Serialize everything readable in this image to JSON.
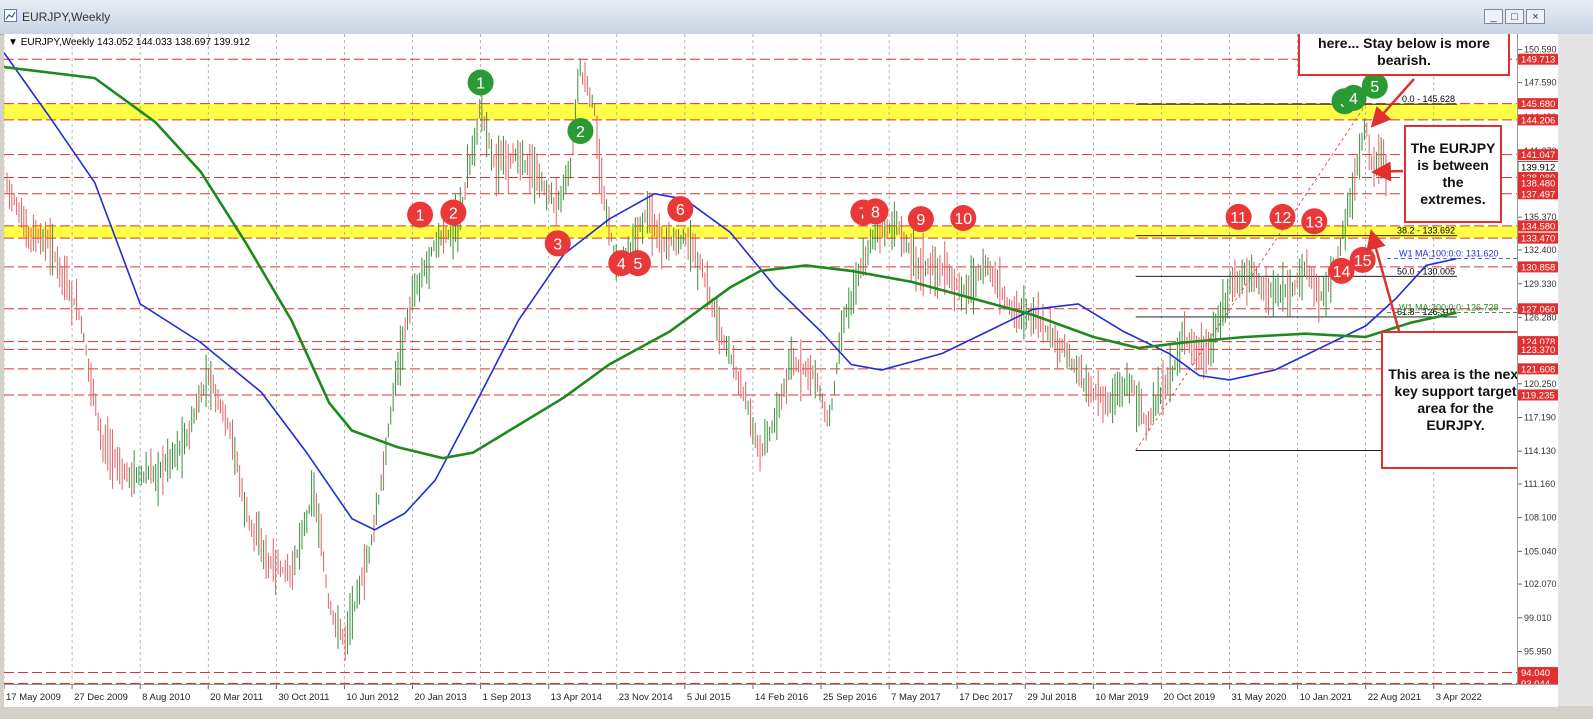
{
  "window": {
    "title": "EURJPY,Weekly",
    "icon": "chart-window-icon",
    "buttons": [
      "_",
      "□",
      "×"
    ]
  },
  "symbol_line": "EURJPY,Weekly  143.052 144.033 138.697 139.912",
  "callouts": {
    "top": "Resistance stalled the rally here... Stay below is more bearish.",
    "middle": "The EURJPY is between the extremes.",
    "bottom": "This area is the next key support target area for the EURJPY."
  },
  "colors": {
    "bull_bar": "#3a8f3a",
    "bear_bar": "#e06060",
    "ma100": "#1f2fcf",
    "ma200": "#1e8a1e",
    "zone": "#ffff33",
    "resistance": "#e03030",
    "fib": "#000000"
  },
  "chart_data": {
    "type": "candlestick",
    "title": "EURJPY,Weekly",
    "timeframe": "Weekly",
    "ohlc_last": {
      "open": 143.052,
      "high": 144.033,
      "low": 138.697,
      "close": 139.912
    },
    "ylim": [
      93.0,
      152.0
    ],
    "xlabel": "",
    "ylabel": "",
    "x_ticks": [
      "17 May 2009",
      "27 Dec 2009",
      "8 Aug 2010",
      "20 Mar 2011",
      "30 Oct 2011",
      "10 Jun 2012",
      "20 Jan 2013",
      "1 Sep 2013",
      "13 Apr 2014",
      "23 Nov 2014",
      "5 Jul 2015",
      "14 Feb 2016",
      "25 Sep 2016",
      "7 May 2017",
      "17 Dec 2017",
      "29 Jul 2018",
      "10 Mar 2019",
      "20 Oct 2019",
      "31 May 2020",
      "10 Jan 2021",
      "22 Aug 2021",
      "3 Apr 2022"
    ],
    "x_tick_frac": [
      0.0,
      0.045,
      0.09,
      0.135,
      0.18,
      0.225,
      0.27,
      0.315,
      0.36,
      0.405,
      0.45,
      0.495,
      0.54,
      0.585,
      0.63,
      0.675,
      0.72,
      0.765,
      0.81,
      0.855,
      0.9,
      0.945
    ],
    "y_tick_labels": [
      "150.590",
      "147.590",
      "144.480",
      "141.370",
      "138.470",
      "135.370",
      "132.400",
      "129.330",
      "126.280",
      "123.310",
      "120.250",
      "117.190",
      "114.130",
      "111.160",
      "108.100",
      "105.040",
      "102.070",
      "99.010",
      "95.950",
      "92.980"
    ],
    "y_ticks": [
      150.59,
      147.59,
      144.48,
      141.37,
      138.47,
      135.37,
      132.4,
      129.33,
      126.28,
      123.31,
      120.25,
      117.19,
      114.13,
      111.16,
      108.1,
      105.04,
      102.07,
      99.01,
      95.95,
      92.98
    ],
    "price_boxes": [
      {
        "label": "149.713",
        "value": 149.713
      },
      {
        "label": "145.680",
        "value": 145.68
      },
      {
        "label": "144.206",
        "value": 144.206
      },
      {
        "label": "141.047",
        "value": 141.047
      },
      {
        "label": "139.912",
        "value": 139.912,
        "kind": "current"
      },
      {
        "label": "138.980",
        "value": 138.98
      },
      {
        "label": "138.480",
        "value": 138.48
      },
      {
        "label": "137.497",
        "value": 137.497
      },
      {
        "label": "134.580",
        "value": 134.58
      },
      {
        "label": "133.470",
        "value": 133.47
      },
      {
        "label": "130.858",
        "value": 130.858
      },
      {
        "label": "127.060",
        "value": 127.06
      },
      {
        "label": "124.078",
        "value": 124.078
      },
      {
        "label": "123.370",
        "value": 123.37
      },
      {
        "label": "121.608",
        "value": 121.608
      },
      {
        "label": "119.235",
        "value": 119.235
      },
      {
        "label": "94.040",
        "value": 94.04
      },
      {
        "label": "93.044",
        "value": 93.044
      }
    ],
    "resistance_lines": [
      149.713,
      145.68,
      144.206,
      141.047,
      138.98,
      137.497,
      134.58,
      133.47,
      130.858,
      127.06,
      124.078,
      123.37,
      121.608,
      119.235,
      94.04,
      93.044
    ],
    "zones": [
      {
        "from": 144.206,
        "to": 145.68
      },
      {
        "from": 133.47,
        "to": 134.58
      }
    ],
    "fib_levels": [
      {
        "label": "0.0 - 145.628",
        "value": 145.628
      },
      {
        "label": "38.2 - 133.692",
        "value": 133.692
      },
      {
        "label": "50.0 - 130.005",
        "value": 130.005
      },
      {
        "label": "61.8 - 126.319",
        "value": 126.319
      }
    ],
    "fib_anchor_low": 114.2,
    "ma_labels": [
      {
        "label": "W1 MA:100:0:0: 131.620",
        "value": 131.62
      },
      {
        "label": "W1 MA:200:0:0: 126.728",
        "value": 126.728
      }
    ],
    "ma100": [
      [
        0.0,
        150.3
      ],
      [
        0.03,
        144.5
      ],
      [
        0.06,
        138.5
      ],
      [
        0.09,
        127.5
      ],
      [
        0.13,
        124.0
      ],
      [
        0.17,
        119.5
      ],
      [
        0.2,
        114.0
      ],
      [
        0.23,
        108.0
      ],
      [
        0.245,
        107.0
      ],
      [
        0.265,
        108.5
      ],
      [
        0.285,
        111.5
      ],
      [
        0.31,
        118.0
      ],
      [
        0.34,
        126.0
      ],
      [
        0.37,
        132.0
      ],
      [
        0.4,
        135.2
      ],
      [
        0.43,
        137.5
      ],
      [
        0.45,
        137.0
      ],
      [
        0.48,
        134.0
      ],
      [
        0.51,
        129.0
      ],
      [
        0.54,
        125.0
      ],
      [
        0.56,
        122.0
      ],
      [
        0.58,
        121.5
      ],
      [
        0.62,
        123.0
      ],
      [
        0.65,
        125.0
      ],
      [
        0.68,
        127.0
      ],
      [
        0.71,
        127.5
      ],
      [
        0.74,
        125.0
      ],
      [
        0.77,
        123.0
      ],
      [
        0.79,
        121.0
      ],
      [
        0.81,
        120.6
      ],
      [
        0.84,
        121.5
      ],
      [
        0.87,
        123.5
      ],
      [
        0.9,
        125.5
      ],
      [
        0.92,
        128.0
      ],
      [
        0.94,
        131.0
      ],
      [
        0.96,
        131.6
      ]
    ],
    "ma200": [
      [
        0.0,
        149.0
      ],
      [
        0.06,
        148.0
      ],
      [
        0.1,
        144.0
      ],
      [
        0.13,
        139.5
      ],
      [
        0.16,
        133.0
      ],
      [
        0.19,
        126.0
      ],
      [
        0.215,
        118.5
      ],
      [
        0.23,
        116.0
      ],
      [
        0.26,
        114.5
      ],
      [
        0.29,
        113.5
      ],
      [
        0.31,
        114.0
      ],
      [
        0.34,
        116.5
      ],
      [
        0.37,
        119.0
      ],
      [
        0.4,
        122.0
      ],
      [
        0.44,
        125.0
      ],
      [
        0.48,
        129.0
      ],
      [
        0.5,
        130.5
      ],
      [
        0.53,
        131.0
      ],
      [
        0.56,
        130.5
      ],
      [
        0.6,
        129.5
      ],
      [
        0.64,
        128.0
      ],
      [
        0.68,
        126.5
      ],
      [
        0.72,
        124.5
      ],
      [
        0.75,
        123.5
      ],
      [
        0.78,
        124.0
      ],
      [
        0.82,
        124.5
      ],
      [
        0.86,
        124.8
      ],
      [
        0.9,
        124.5
      ],
      [
        0.93,
        125.8
      ],
      [
        0.96,
        126.7
      ]
    ],
    "price_path": [
      [
        0.0,
        139.3
      ],
      [
        0.015,
        134.0
      ],
      [
        0.03,
        133.0
      ],
      [
        0.05,
        126.5
      ],
      [
        0.065,
        115.0
      ],
      [
        0.08,
        112.0
      ],
      [
        0.1,
        112.0
      ],
      [
        0.12,
        115.0
      ],
      [
        0.135,
        121.0
      ],
      [
        0.15,
        116.0
      ],
      [
        0.16,
        108.5
      ],
      [
        0.175,
        104.0
      ],
      [
        0.19,
        103.0
      ],
      [
        0.205,
        110.5
      ],
      [
        0.215,
        100.0
      ],
      [
        0.225,
        97.0
      ],
      [
        0.24,
        104.0
      ],
      [
        0.25,
        111.5
      ],
      [
        0.26,
        122.0
      ],
      [
        0.27,
        128.0
      ],
      [
        0.285,
        133.0
      ],
      [
        0.3,
        134.5
      ],
      [
        0.31,
        141.5
      ],
      [
        0.315,
        145.5
      ],
      [
        0.325,
        140.0
      ],
      [
        0.34,
        141.0
      ],
      [
        0.355,
        138.5
      ],
      [
        0.365,
        136.5
      ],
      [
        0.375,
        140.0
      ],
      [
        0.38,
        149.0
      ],
      [
        0.39,
        145.5
      ],
      [
        0.395,
        138.0
      ],
      [
        0.405,
        131.0
      ],
      [
        0.415,
        132.5
      ],
      [
        0.425,
        136.0
      ],
      [
        0.435,
        133.0
      ],
      [
        0.45,
        133.5
      ],
      [
        0.46,
        131.0
      ],
      [
        0.475,
        124.5
      ],
      [
        0.49,
        119.0
      ],
      [
        0.5,
        114.0
      ],
      [
        0.51,
        117.0
      ],
      [
        0.52,
        122.0
      ],
      [
        0.535,
        121.5
      ],
      [
        0.545,
        116.5
      ],
      [
        0.555,
        126.0
      ],
      [
        0.565,
        130.0
      ],
      [
        0.575,
        134.0
      ],
      [
        0.59,
        134.5
      ],
      [
        0.605,
        131.0
      ],
      [
        0.62,
        130.5
      ],
      [
        0.635,
        128.5
      ],
      [
        0.65,
        131.0
      ],
      [
        0.665,
        127.0
      ],
      [
        0.68,
        126.5
      ],
      [
        0.7,
        123.5
      ],
      [
        0.715,
        120.0
      ],
      [
        0.73,
        118.5
      ],
      [
        0.745,
        120.5
      ],
      [
        0.755,
        116.5
      ],
      [
        0.77,
        120.5
      ],
      [
        0.78,
        124.5
      ],
      [
        0.795,
        122.5
      ],
      [
        0.81,
        129.0
      ],
      [
        0.825,
        130.5
      ],
      [
        0.835,
        128.5
      ],
      [
        0.85,
        128.5
      ],
      [
        0.86,
        131.0
      ],
      [
        0.87,
        128.0
      ],
      [
        0.88,
        131.0
      ],
      [
        0.89,
        137.0
      ],
      [
        0.9,
        144.0
      ],
      [
        0.905,
        139.5
      ],
      [
        0.91,
        141.0
      ],
      [
        0.913,
        139.9
      ]
    ],
    "bar_x_range": [
      0.002,
      0.915
    ],
    "fib_start_x": 0.748,
    "swing_low_x": 0.748,
    "markers_green": [
      {
        "label": "1",
        "x": 0.315,
        "y": 147.6
      },
      {
        "label": "2",
        "x": 0.381,
        "y": 143.2
      },
      {
        "label": "3",
        "x": 0.886,
        "y": 145.9
      },
      {
        "label": "4",
        "x": 0.892,
        "y": 146.2
      },
      {
        "label": "5",
        "x": 0.906,
        "y": 147.3
      }
    ],
    "markers_red": [
      {
        "label": "1",
        "x": 0.275,
        "y": 135.6
      },
      {
        "label": "2",
        "x": 0.297,
        "y": 135.8
      },
      {
        "label": "3",
        "x": 0.366,
        "y": 133.0
      },
      {
        "label": "4",
        "x": 0.408,
        "y": 131.2
      },
      {
        "label": "5",
        "x": 0.419,
        "y": 131.2
      },
      {
        "label": "6",
        "x": 0.447,
        "y": 136.1
      },
      {
        "label": "7",
        "x": 0.568,
        "y": 135.8
      },
      {
        "label": "8",
        "x": 0.576,
        "y": 135.9
      },
      {
        "label": "9",
        "x": 0.606,
        "y": 135.2
      },
      {
        "label": "10",
        "x": 0.634,
        "y": 135.3
      },
      {
        "label": "11",
        "x": 0.816,
        "y": 135.4
      },
      {
        "label": "12",
        "x": 0.845,
        "y": 135.4
      },
      {
        "label": "13",
        "x": 0.866,
        "y": 135.0
      },
      {
        "label": "14",
        "x": 0.884,
        "y": 130.5
      },
      {
        "label": "15",
        "x": 0.898,
        "y": 131.5
      }
    ]
  }
}
